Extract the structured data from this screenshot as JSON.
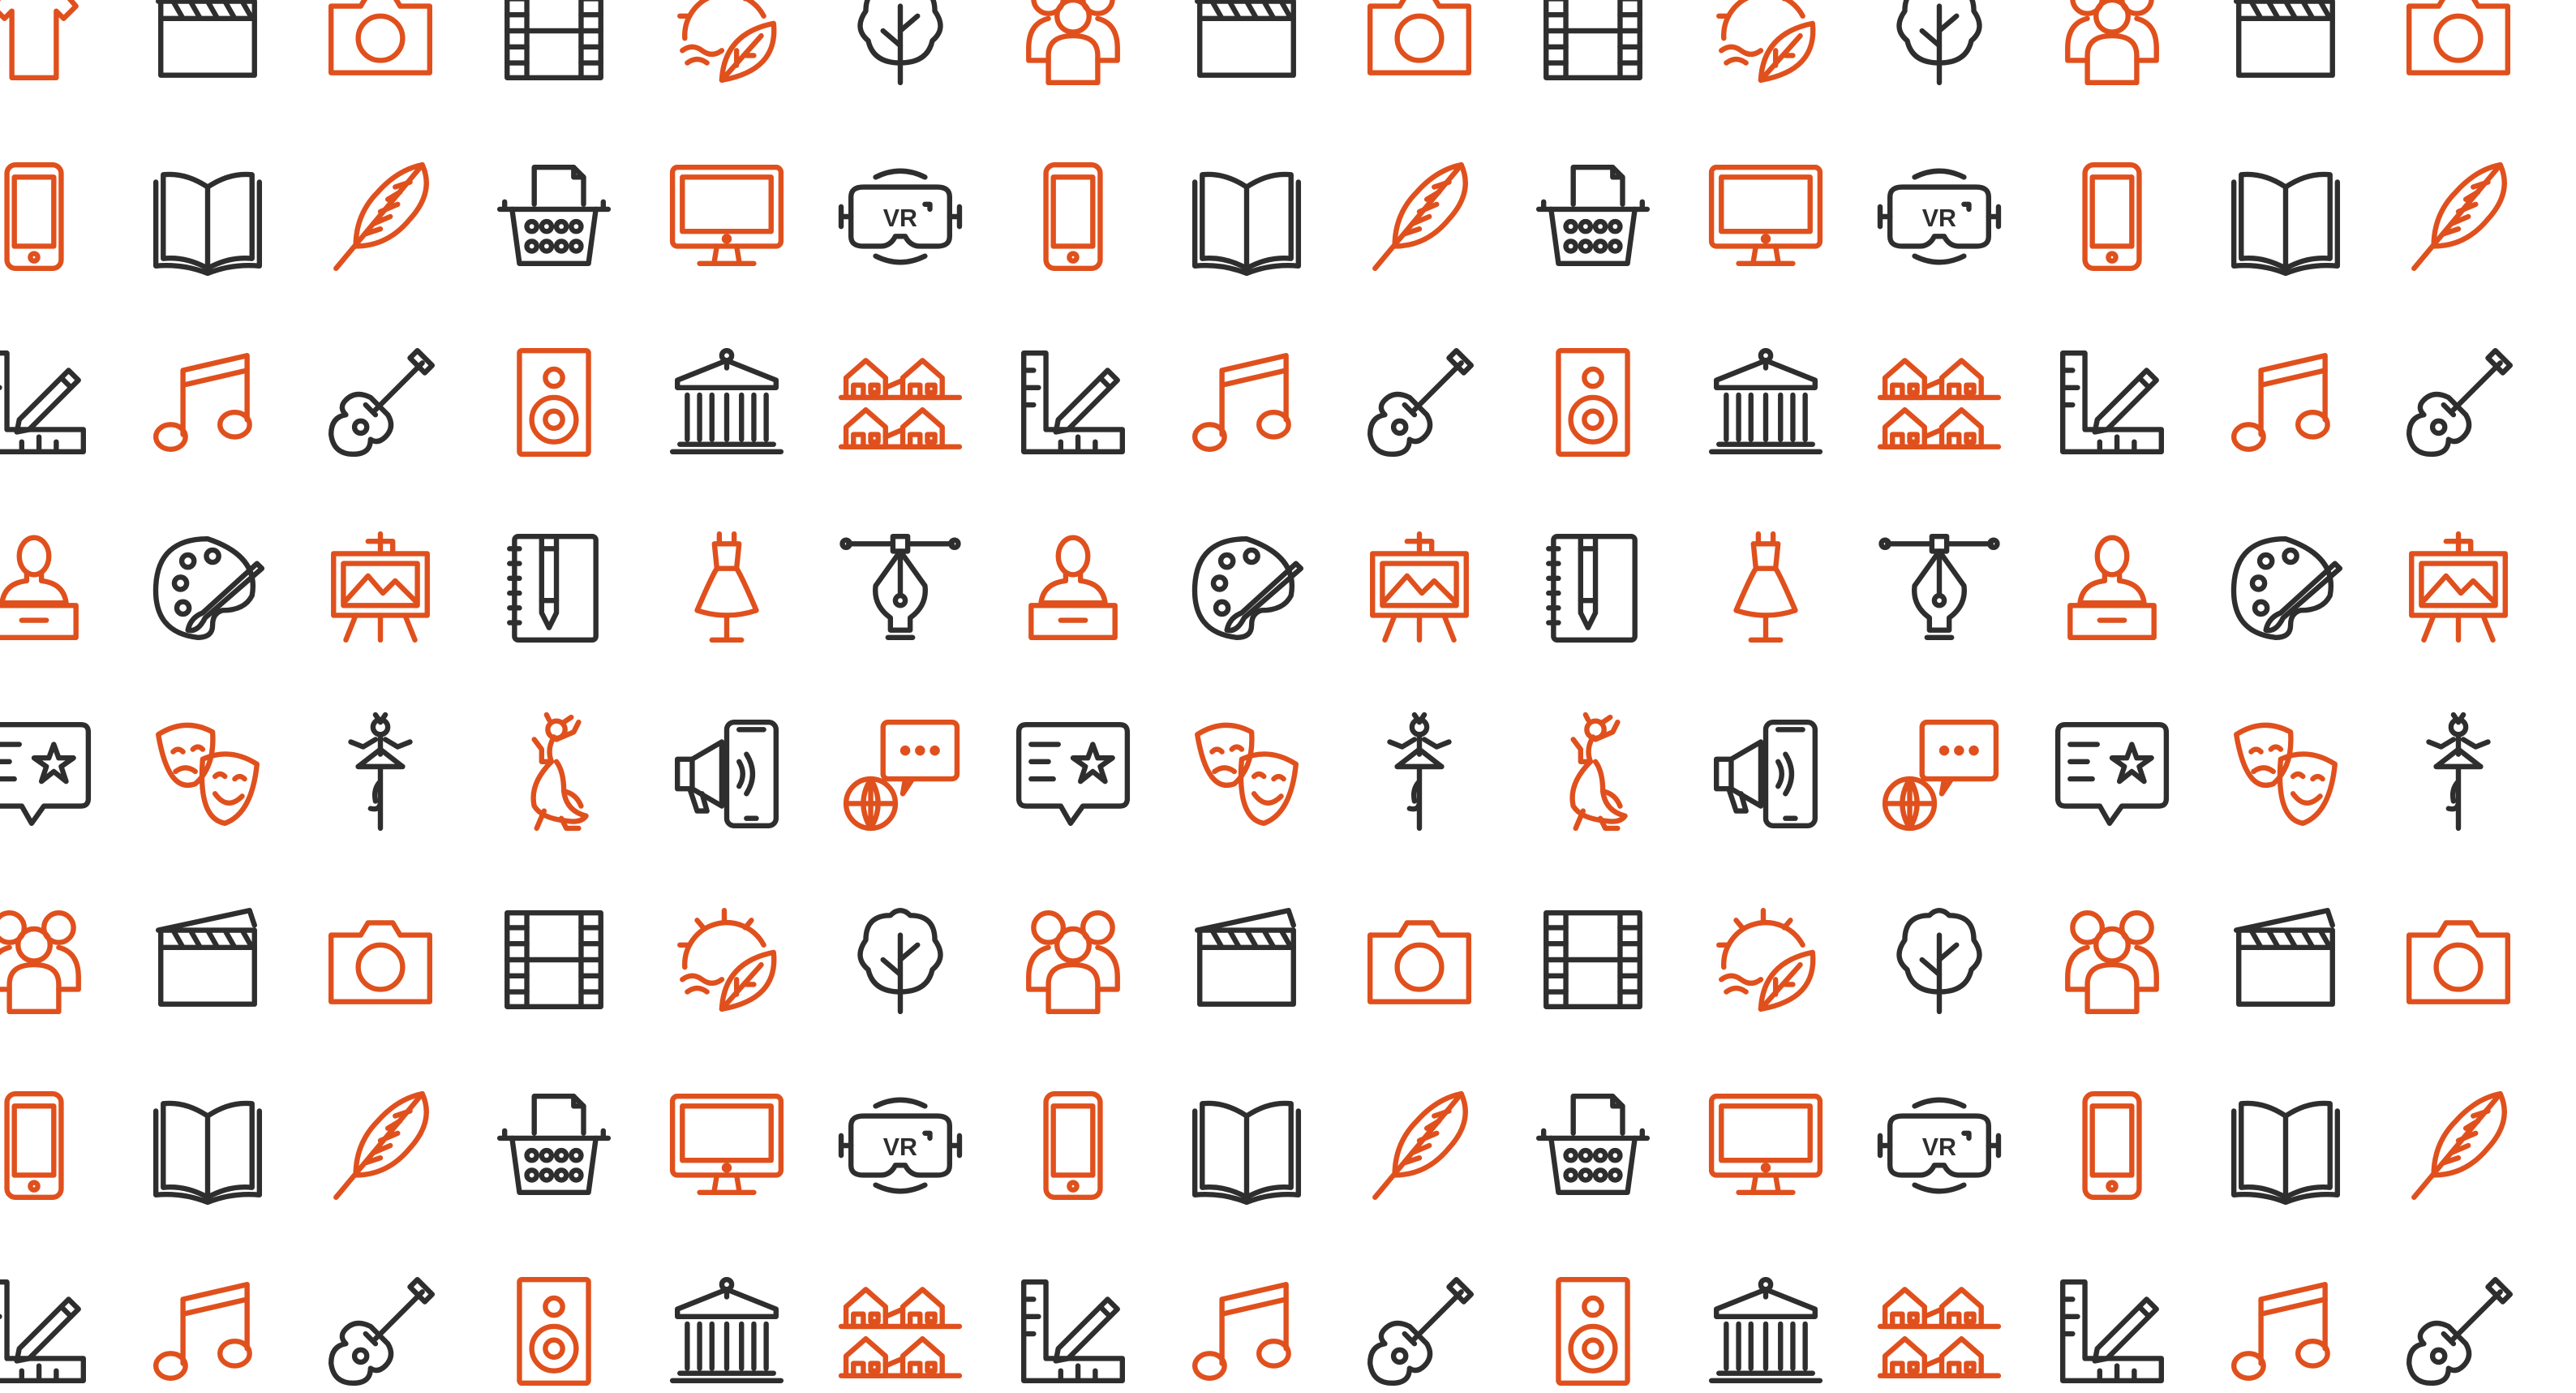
{
  "colors": {
    "accent": "#e0501d",
    "dark": "#2e2e2e",
    "background": "#ffffff"
  },
  "pattern": {
    "description_free_rows": [
      {
        "start_col": 0,
        "cells": [
          {
            "icon": "tshirt-icon",
            "color": "accent"
          },
          {
            "icon": "clapperboard-icon",
            "color": "dark"
          },
          {
            "icon": "camera-icon",
            "color": "accent"
          },
          {
            "icon": "film-strip-icon",
            "color": "dark"
          },
          {
            "icon": "nature-sun-leaf-icon",
            "color": "accent"
          },
          {
            "icon": "tree-icon",
            "color": "dark"
          },
          {
            "icon": "people-group-icon",
            "color": "accent"
          },
          {
            "icon": "clapperboard-icon",
            "color": "dark"
          },
          {
            "icon": "camera-icon",
            "color": "accent"
          },
          {
            "icon": "film-strip-icon",
            "color": "dark"
          },
          {
            "icon": "nature-sun-leaf-icon",
            "color": "accent"
          },
          {
            "icon": "tree-icon",
            "color": "dark"
          },
          {
            "icon": "people-group-icon",
            "color": "accent"
          },
          {
            "icon": "clapperboard-icon",
            "color": "dark"
          },
          {
            "icon": "camera-icon",
            "color": "accent"
          }
        ]
      },
      {
        "start_col": 0,
        "cells": [
          {
            "icon": "smartphone-icon",
            "color": "accent"
          },
          {
            "icon": "open-book-icon",
            "color": "dark"
          },
          {
            "icon": "feather-quill-icon",
            "color": "accent"
          },
          {
            "icon": "typewriter-icon",
            "color": "dark"
          },
          {
            "icon": "monitor-icon",
            "color": "accent"
          },
          {
            "icon": "vr-headset-icon",
            "color": "dark"
          },
          {
            "icon": "smartphone-icon",
            "color": "accent"
          },
          {
            "icon": "open-book-icon",
            "color": "dark"
          },
          {
            "icon": "feather-quill-icon",
            "color": "accent"
          },
          {
            "icon": "typewriter-icon",
            "color": "dark"
          },
          {
            "icon": "monitor-icon",
            "color": "accent"
          },
          {
            "icon": "vr-headset-icon",
            "color": "dark"
          },
          {
            "icon": "smartphone-icon",
            "color": "accent"
          },
          {
            "icon": "open-book-icon",
            "color": "dark"
          },
          {
            "icon": "feather-quill-icon",
            "color": "accent"
          }
        ]
      },
      {
        "start_col": 0,
        "cells": [
          {
            "icon": "ruler-pencil-icon",
            "color": "dark"
          },
          {
            "icon": "music-note-icon",
            "color": "accent"
          },
          {
            "icon": "guitar-icon",
            "color": "dark"
          },
          {
            "icon": "speaker-icon",
            "color": "accent"
          },
          {
            "icon": "museum-icon",
            "color": "dark"
          },
          {
            "icon": "houses-icon",
            "color": "accent"
          },
          {
            "icon": "ruler-pencil-icon",
            "color": "dark"
          },
          {
            "icon": "music-note-icon",
            "color": "accent"
          },
          {
            "icon": "guitar-icon",
            "color": "dark"
          },
          {
            "icon": "speaker-icon",
            "color": "accent"
          },
          {
            "icon": "museum-icon",
            "color": "dark"
          },
          {
            "icon": "houses-icon",
            "color": "accent"
          },
          {
            "icon": "ruler-pencil-icon",
            "color": "dark"
          },
          {
            "icon": "music-note-icon",
            "color": "accent"
          },
          {
            "icon": "guitar-icon",
            "color": "dark"
          }
        ]
      },
      {
        "start_col": 0,
        "cells": [
          {
            "icon": "bust-sculpture-icon",
            "color": "accent"
          },
          {
            "icon": "paint-palette-icon",
            "color": "dark"
          },
          {
            "icon": "easel-painting-icon",
            "color": "accent"
          },
          {
            "icon": "sketchbook-icon",
            "color": "dark"
          },
          {
            "icon": "dress-form-icon",
            "color": "accent"
          },
          {
            "icon": "pen-tool-icon",
            "color": "dark"
          },
          {
            "icon": "bust-sculpture-icon",
            "color": "accent"
          },
          {
            "icon": "paint-palette-icon",
            "color": "dark"
          },
          {
            "icon": "easel-painting-icon",
            "color": "accent"
          },
          {
            "icon": "sketchbook-icon",
            "color": "dark"
          },
          {
            "icon": "dress-form-icon",
            "color": "accent"
          },
          {
            "icon": "pen-tool-icon",
            "color": "dark"
          },
          {
            "icon": "bust-sculpture-icon",
            "color": "accent"
          },
          {
            "icon": "paint-palette-icon",
            "color": "dark"
          },
          {
            "icon": "easel-painting-icon",
            "color": "accent"
          }
        ]
      },
      {
        "start_col": 0,
        "cells": [
          {
            "icon": "review-star-bubble-icon",
            "color": "dark"
          },
          {
            "icon": "theater-masks-icon",
            "color": "accent"
          },
          {
            "icon": "ballerina-icon",
            "color": "dark"
          },
          {
            "icon": "flamenco-dancer-icon",
            "color": "accent"
          },
          {
            "icon": "phone-megaphone-icon",
            "color": "dark"
          },
          {
            "icon": "global-chat-icon",
            "color": "accent"
          },
          {
            "icon": "review-star-bubble-icon",
            "color": "dark"
          },
          {
            "icon": "theater-masks-icon",
            "color": "accent"
          },
          {
            "icon": "ballerina-icon",
            "color": "dark"
          },
          {
            "icon": "flamenco-dancer-icon",
            "color": "accent"
          },
          {
            "icon": "phone-megaphone-icon",
            "color": "dark"
          },
          {
            "icon": "global-chat-icon",
            "color": "accent"
          },
          {
            "icon": "review-star-bubble-icon",
            "color": "dark"
          },
          {
            "icon": "theater-masks-icon",
            "color": "accent"
          },
          {
            "icon": "ballerina-icon",
            "color": "dark"
          }
        ]
      },
      {
        "start_col": 0,
        "cells": [
          {
            "icon": "people-group-icon",
            "color": "accent"
          },
          {
            "icon": "clapperboard-icon",
            "color": "dark"
          },
          {
            "icon": "camera-icon",
            "color": "accent"
          },
          {
            "icon": "film-strip-icon",
            "color": "dark"
          },
          {
            "icon": "nature-sun-leaf-icon",
            "color": "accent"
          },
          {
            "icon": "tree-icon",
            "color": "dark"
          },
          {
            "icon": "people-group-icon",
            "color": "accent"
          },
          {
            "icon": "clapperboard-icon",
            "color": "dark"
          },
          {
            "icon": "camera-icon",
            "color": "accent"
          },
          {
            "icon": "film-strip-icon",
            "color": "dark"
          },
          {
            "icon": "nature-sun-leaf-icon",
            "color": "accent"
          },
          {
            "icon": "tree-icon",
            "color": "dark"
          },
          {
            "icon": "people-group-icon",
            "color": "accent"
          },
          {
            "icon": "clapperboard-icon",
            "color": "dark"
          },
          {
            "icon": "camera-icon",
            "color": "accent"
          }
        ]
      },
      {
        "start_col": 0,
        "cells": [
          {
            "icon": "smartphone-icon",
            "color": "accent"
          },
          {
            "icon": "open-book-icon",
            "color": "dark"
          },
          {
            "icon": "feather-quill-icon",
            "color": "accent"
          },
          {
            "icon": "typewriter-icon",
            "color": "dark"
          },
          {
            "icon": "monitor-icon",
            "color": "accent"
          },
          {
            "icon": "vr-headset-icon",
            "color": "dark"
          },
          {
            "icon": "smartphone-icon",
            "color": "accent"
          },
          {
            "icon": "open-book-icon",
            "color": "dark"
          },
          {
            "icon": "feather-quill-icon",
            "color": "accent"
          },
          {
            "icon": "typewriter-icon",
            "color": "dark"
          },
          {
            "icon": "monitor-icon",
            "color": "accent"
          },
          {
            "icon": "vr-headset-icon",
            "color": "dark"
          },
          {
            "icon": "smartphone-icon",
            "color": "accent"
          },
          {
            "icon": "open-book-icon",
            "color": "dark"
          },
          {
            "icon": "feather-quill-icon",
            "color": "accent"
          }
        ]
      },
      {
        "start_col": 0,
        "cells": [
          {
            "icon": "ruler-pencil-icon",
            "color": "dark"
          },
          {
            "icon": "music-note-icon",
            "color": "accent"
          },
          {
            "icon": "guitar-icon",
            "color": "dark"
          },
          {
            "icon": "speaker-icon",
            "color": "accent"
          },
          {
            "icon": "museum-icon",
            "color": "dark"
          },
          {
            "icon": "houses-icon",
            "color": "accent"
          },
          {
            "icon": "ruler-pencil-icon",
            "color": "dark"
          },
          {
            "icon": "music-note-icon",
            "color": "accent"
          },
          {
            "icon": "guitar-icon",
            "color": "dark"
          },
          {
            "icon": "speaker-icon",
            "color": "accent"
          },
          {
            "icon": "museum-icon",
            "color": "dark"
          },
          {
            "icon": "houses-icon",
            "color": "accent"
          },
          {
            "icon": "ruler-pencil-icon",
            "color": "dark"
          },
          {
            "icon": "music-note-icon",
            "color": "accent"
          },
          {
            "icon": "guitar-icon",
            "color": "dark"
          }
        ]
      }
    ]
  },
  "labels": {
    "vr_text": "VR"
  }
}
